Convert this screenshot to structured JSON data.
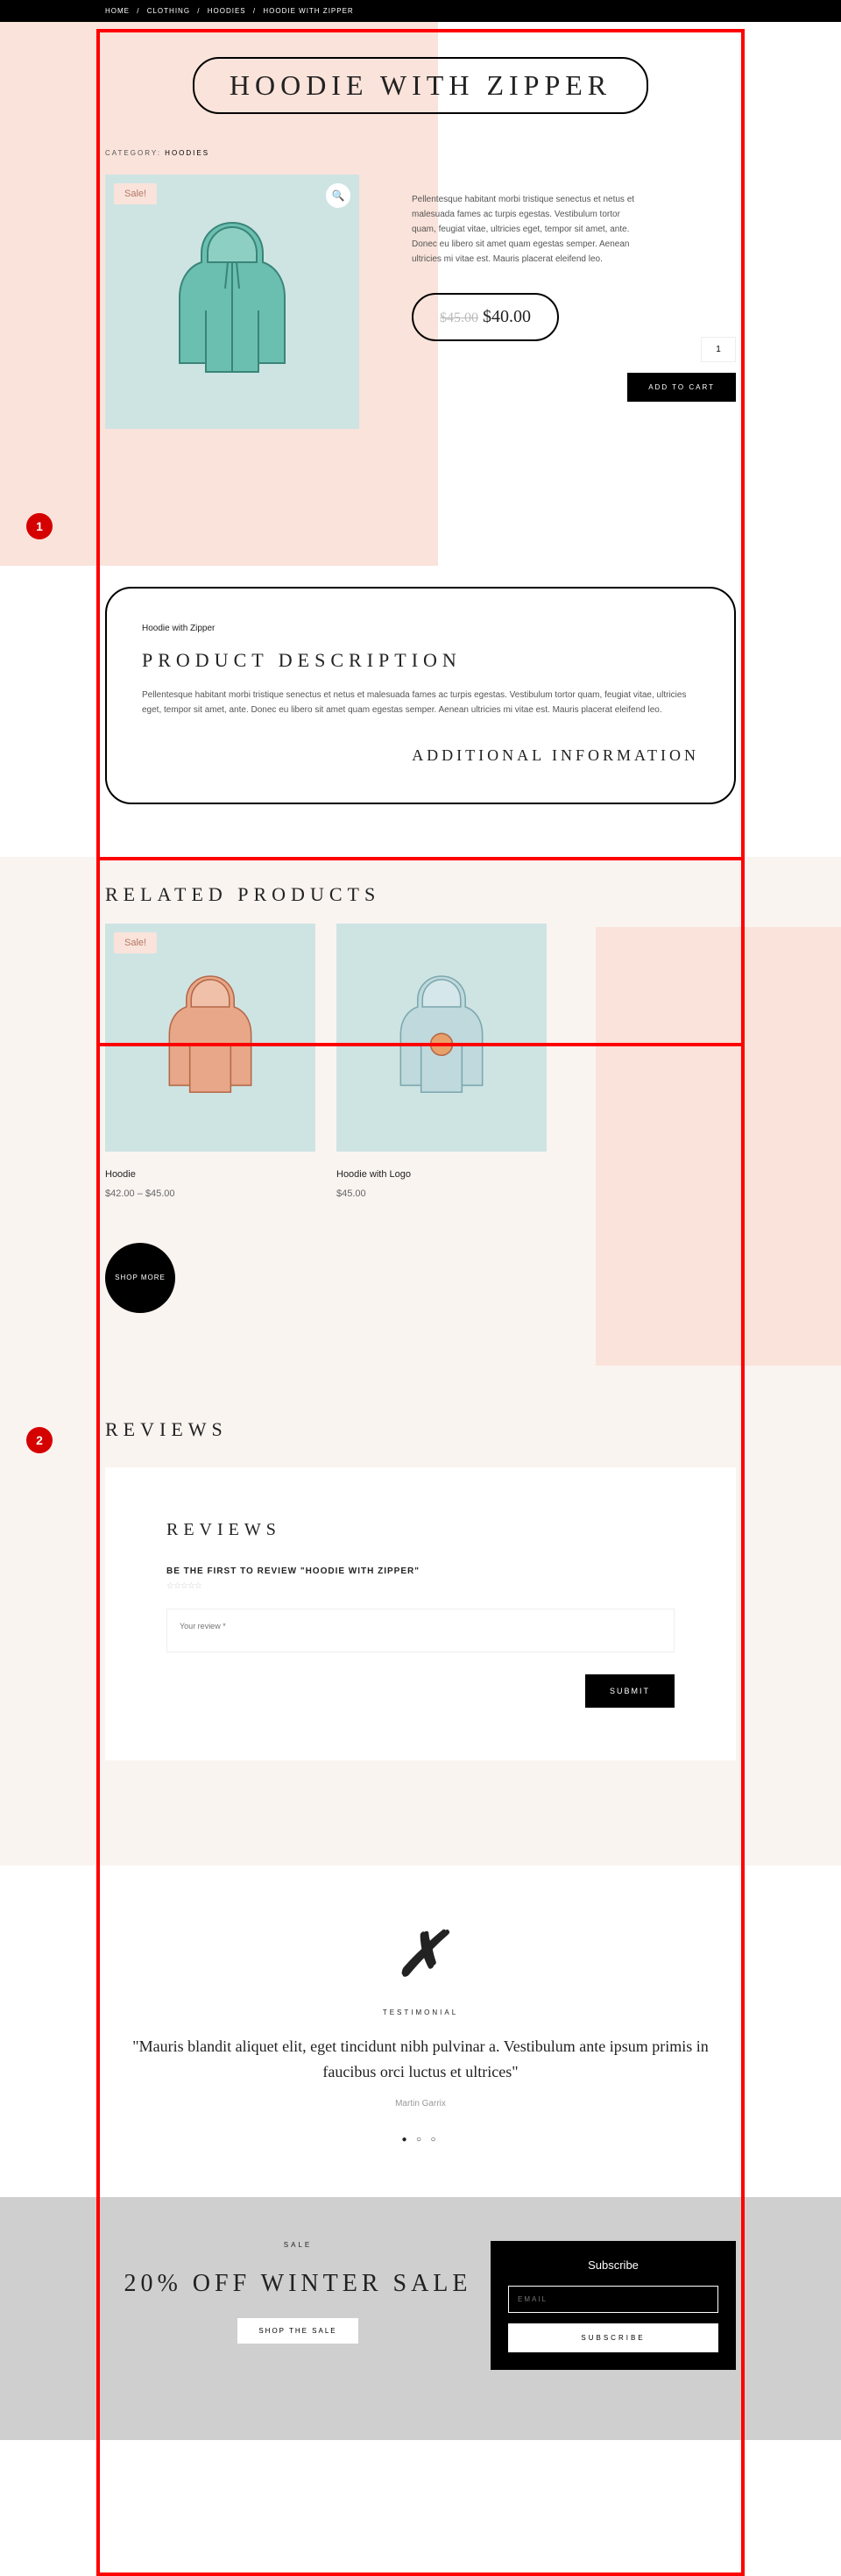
{
  "breadcrumb": {
    "home": "HOME",
    "clothing": "CLOTHING",
    "hoodies": "HOODIES",
    "current": "HOODIE WITH ZIPPER"
  },
  "title": "HOODIE WITH ZIPPER",
  "category": {
    "label": "CATEGORY:",
    "value": "HOODIES"
  },
  "sale_badge": "Sale!",
  "short_desc": "Pellentesque habitant morbi tristique senectus et netus et malesuada fames ac turpis egestas. Vestibulum tortor quam, feugiat vitae, ultricies eget, tempor sit amet, ante. Donec eu libero sit amet quam egestas semper. Aenean ultricies mi vitae est. Mauris placerat eleifend leo.",
  "price": {
    "old": "$45.00",
    "new": "$40.00"
  },
  "qty": "1",
  "add_to_cart": "ADD TO CART",
  "tabs": {
    "name": "Hoodie with Zipper",
    "desc_title": "PRODUCT DESCRIPTION",
    "desc_text": "Pellentesque habitant morbi tristique senectus et netus et malesuada fames ac turpis egestas. Vestibulum tortor quam, feugiat vitae, ultricies eget, tempor sit amet, ante. Donec eu libero sit amet quam egestas semper. Aenean ultricies mi vitae est. Mauris placerat eleifend leo.",
    "addl_title": "ADDITIONAL INFORMATION"
  },
  "related": {
    "title": "RELATED PRODUCTS",
    "items": [
      {
        "name": "Hoodie",
        "price": "$42.00 – $45.00",
        "sale": true
      },
      {
        "name": "Hoodie with Logo",
        "price": "$45.00",
        "sale": false
      }
    ],
    "shop_more": "SHOP MORE"
  },
  "reviews": {
    "title": "REVIEWS",
    "panel_title": "REVIEWS",
    "first": "BE THE FIRST TO REVIEW \"HOODIE WITH ZIPPER\"",
    "placeholder": "Your review *",
    "submit": "SUBMIT"
  },
  "testimonial": {
    "label": "TESTIMONIAL",
    "quote": "\"Mauris blandit aliquet elit, eget tincidunt nibh pulvinar a. Vestibulum ante ipsum primis in faucibus orci luctus et ultrices\"",
    "author": "Martin Garrix"
  },
  "sale": {
    "tag": "SALE",
    "title": "20% OFF WINTER SALE",
    "button": "SHOP THE SALE"
  },
  "subscribe": {
    "title": "Subscribe",
    "email_ph": "EMAIL",
    "button": "SUBSCRIBE"
  },
  "markers": {
    "m1": "1",
    "m2": "2"
  }
}
